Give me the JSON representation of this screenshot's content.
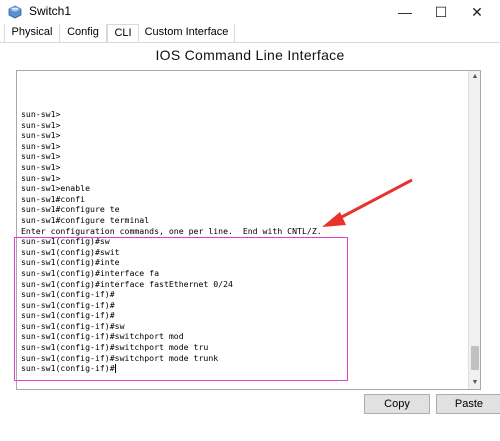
{
  "window": {
    "title": "Switch1",
    "icon": "switch-app-icon",
    "minimize_symbol": "—",
    "maximize_symbol": "☐",
    "close_symbol": "✕"
  },
  "tabs": [
    {
      "label": "Physical"
    },
    {
      "label": "Config"
    },
    {
      "label": "CLI"
    },
    {
      "label": "Custom Interface"
    }
  ],
  "active_tab": "CLI",
  "cli": {
    "heading": "IOS Command Line Interface",
    "lines": [
      "sun-sw1>",
      "sun-sw1>",
      "sun-sw1>",
      "sun-sw1>",
      "sun-sw1>",
      "sun-sw1>",
      "sun-sw1>",
      "sun-sw1>enable",
      "sun-sw1#confi",
      "sun-sw1#configure te",
      "sun-sw1#configure terminal",
      "Enter configuration commands, one per line.  End with CNTL/Z.",
      "sun-sw1(config)#sw",
      "sun-sw1(config)#swit",
      "sun-sw1(config)#inte",
      "sun-sw1(config)#interface fa",
      "sun-sw1(config)#interface fastEthernet 0/24",
      "sun-sw1(config-if)#",
      "sun-sw1(config-if)#",
      "sun-sw1(config-if)#",
      "sun-sw1(config-if)#sw",
      "sun-sw1(config-if)#switchport mod",
      "sun-sw1(config-if)#switchport mode tru",
      "sun-sw1(config-if)#switchport mode trunk",
      "sun-sw1(config-if)#"
    ]
  },
  "buttons": {
    "copy": "Copy",
    "paste": "Paste"
  },
  "annotation": {
    "box_color": "#e040c8",
    "arrow_color": "#e8322c"
  }
}
